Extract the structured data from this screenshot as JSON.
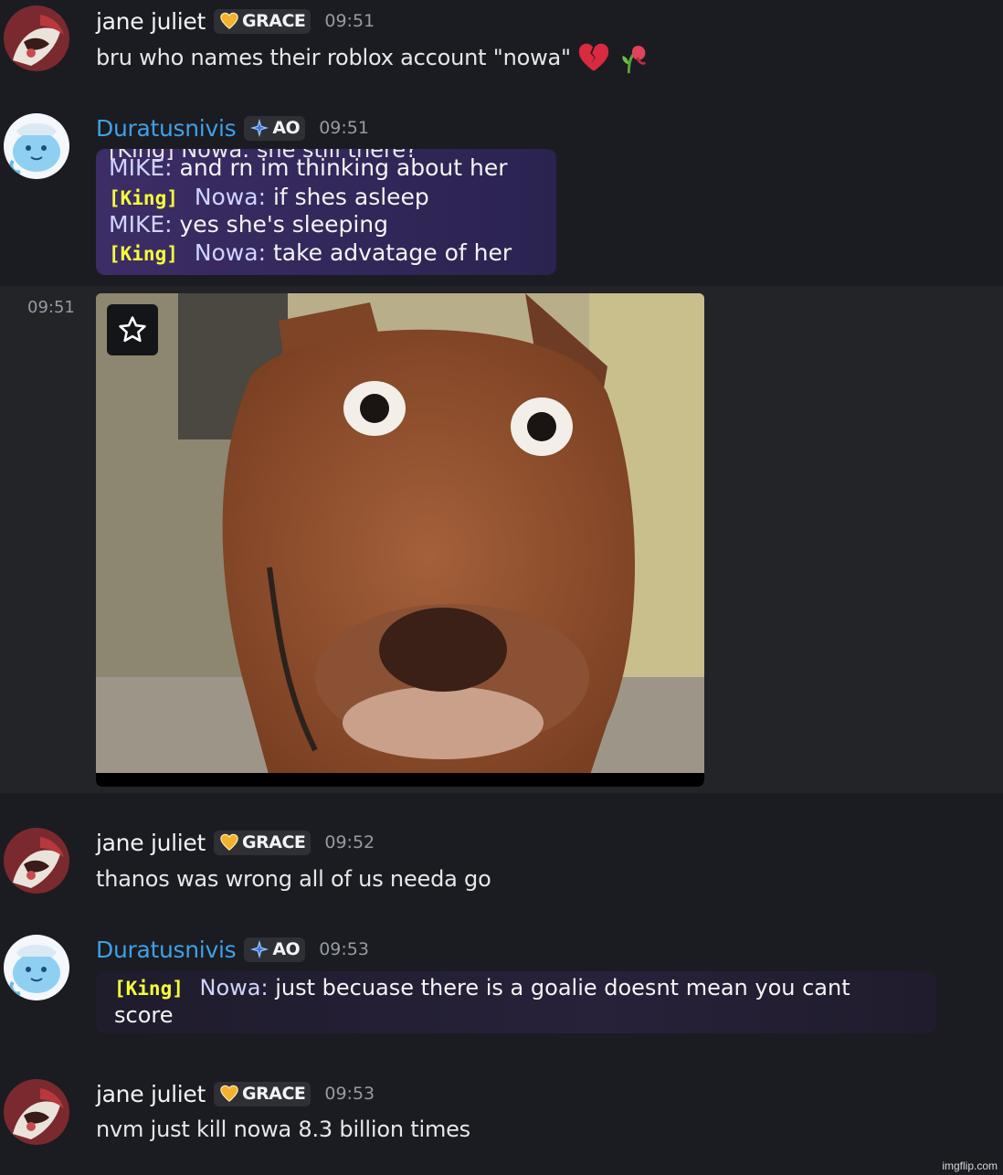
{
  "messages": [
    {
      "author": "jane juliet",
      "tag": "GRACE",
      "time": "09:51",
      "text": "bru who names their roblox account \"nowa\"",
      "emojis": [
        "broken-heart-emoji",
        "wilted-flower-emoji"
      ]
    },
    {
      "author": "Duratusnivis",
      "tag": "AO",
      "time": "09:51",
      "screenshot": {
        "cut_line": "[King] Nowa: she still there?",
        "lines": [
          {
            "prefix": "",
            "speaker": "MIKE:",
            "text": "and rn im thinking about her"
          },
          {
            "prefix": "[King]",
            "speaker": "Nowa:",
            "text": "if shes asleep"
          },
          {
            "prefix": "",
            "speaker": "MIKE:",
            "text": "yes she's sleeping"
          },
          {
            "prefix": "[King]",
            "speaker": "Nowa:",
            "text": "take advatage of her"
          }
        ]
      }
    },
    {
      "side_time": "09:51",
      "attachment": "surprised-dog-gif"
    },
    {
      "author": "jane juliet",
      "tag": "GRACE",
      "time": "09:52",
      "text": "thanos was wrong all of us needa go"
    },
    {
      "author": "Duratusnivis",
      "tag": "AO",
      "time": "09:53",
      "screenshot": {
        "lines": [
          {
            "prefix": "[King]",
            "speaker": "Nowa:",
            "text": "just becuase there is a goalie doesnt mean you cant"
          },
          {
            "prefix": "",
            "speaker": "",
            "text": "score"
          }
        ]
      }
    },
    {
      "author": "jane juliet",
      "tag": "GRACE",
      "time": "09:53",
      "text": "nvm just kill nowa 8.3 billion times"
    }
  ],
  "watermark": "imgflip.com",
  "colors": {
    "background": "#1b1c21",
    "highlight_row": "#232428",
    "username_blue": "#3fa0e6",
    "king_tag": "#f5ff3a",
    "timestamp": "#949ba4"
  }
}
